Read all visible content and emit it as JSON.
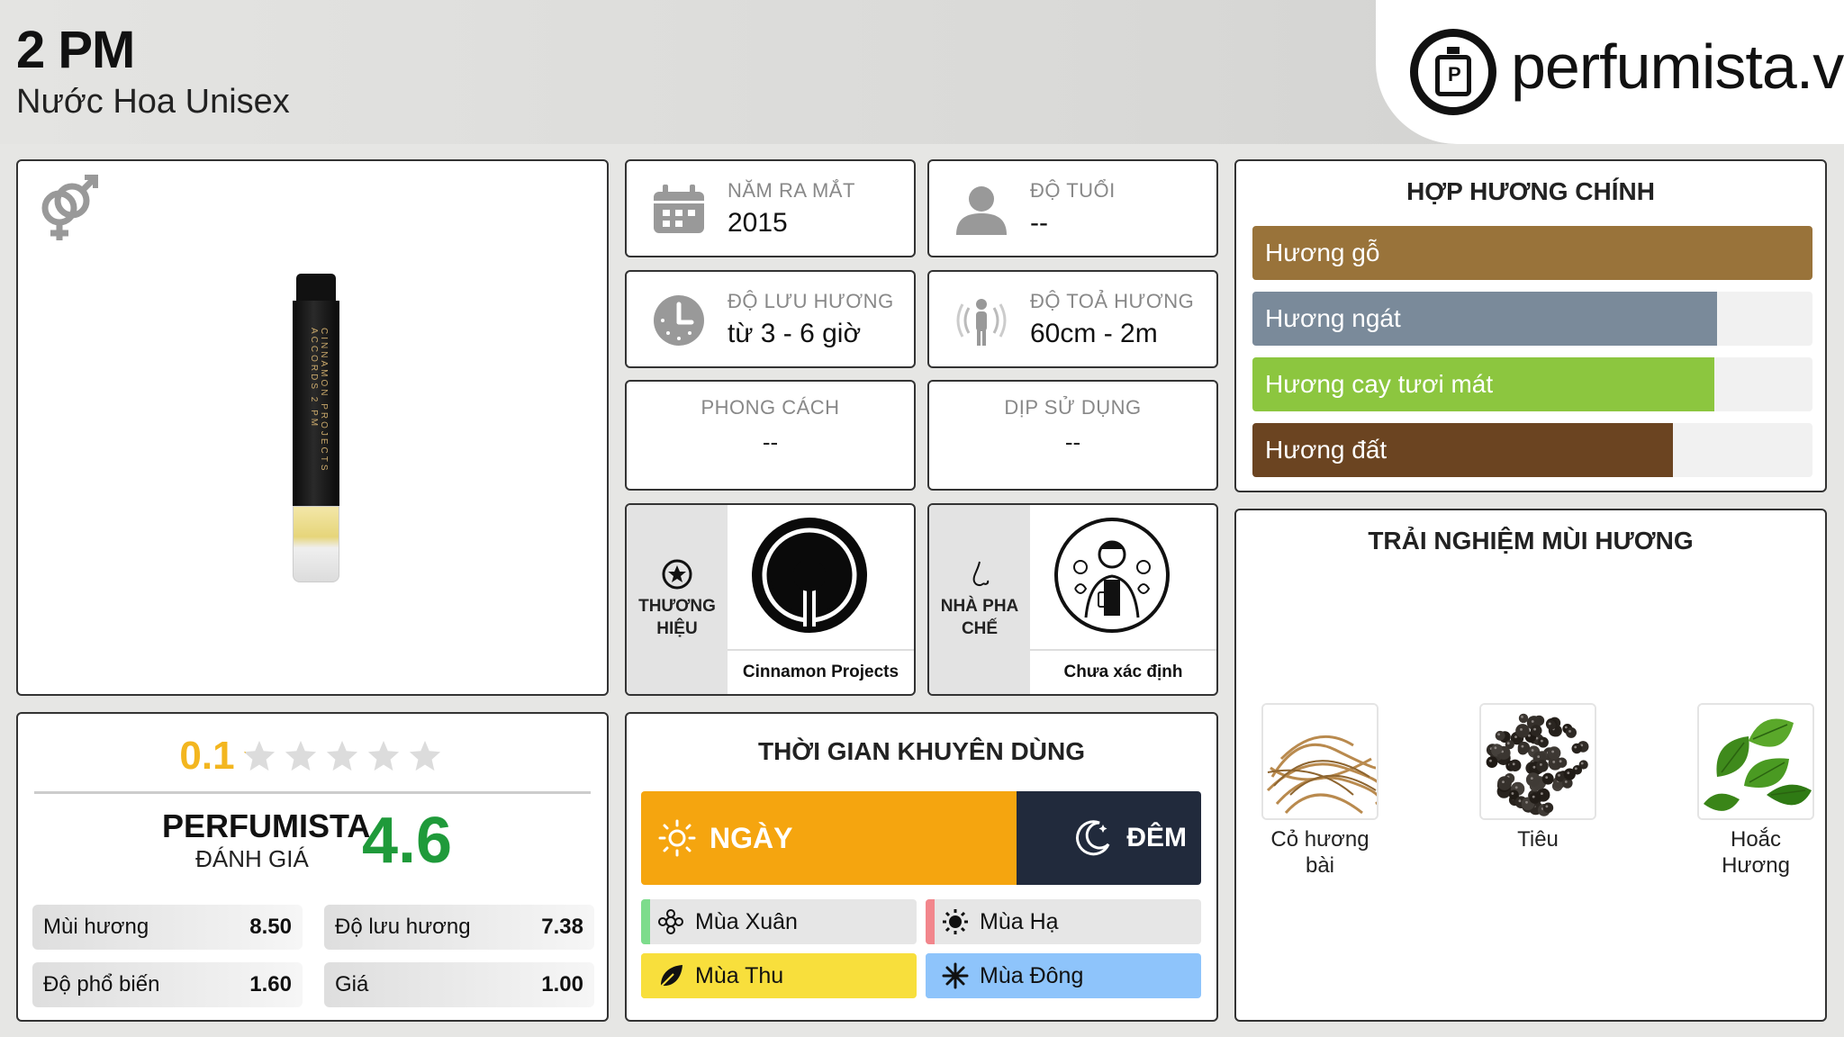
{
  "product": {
    "name": "2 PM",
    "type": "Nước Hoa Unisex",
    "logo_text": "perfumista.vn",
    "bottle_label": "CINNAMON PROJECTS ACCORDS 2 PM"
  },
  "info": {
    "release": {
      "label": "NĂM RA MẮT",
      "value": "2015"
    },
    "age": {
      "label": "ĐỘ TUỔI",
      "value": "--"
    },
    "longevity": {
      "label": "ĐỘ LƯU HƯƠNG",
      "value": "từ 3 - 6 giờ"
    },
    "sillage": {
      "label": "ĐỘ TOẢ HƯƠNG",
      "value": "60cm - 2m"
    },
    "style": {
      "label": "PHONG CÁCH",
      "value": "--"
    },
    "occasion": {
      "label": "DỊP SỬ DỤNG",
      "value": "--"
    }
  },
  "brand": {
    "label": "THƯƠNG HIỆU",
    "name": "Cinnamon Projects"
  },
  "perfumer": {
    "label": "NHÀ PHA CHẾ",
    "name": "Chưa xác định"
  },
  "accords": {
    "title": "HỢP HƯƠNG CHÍNH",
    "items": [
      {
        "name": "Hương gỗ",
        "fill": 1.0,
        "color": "#99733a"
      },
      {
        "name": "Hương ngát",
        "fill": 0.83,
        "color": "#7a8a9a"
      },
      {
        "name": "Hương cay tươi mát",
        "fill": 0.825,
        "color": "#8cc63f"
      },
      {
        "name": "Hương đất",
        "fill": 0.75,
        "color": "#6b4421"
      }
    ]
  },
  "notes": {
    "title": "TRẢI NGHIỆM MÙI HƯƠNG",
    "items": [
      {
        "name": "Cỏ hương bài"
      },
      {
        "name": "Tiêu"
      },
      {
        "name": "Hoắc Hương"
      }
    ]
  },
  "rating": {
    "user_score": "0.1",
    "user_stars": 0.02,
    "perfumista_name": "PERFUMISTA",
    "perfumista_sub": "ĐÁNH GIÁ",
    "perfumista_score": "4.6",
    "metrics": [
      {
        "label": "Mùi hương",
        "value": "8.50"
      },
      {
        "label": "Độ lưu hương",
        "value": "7.38"
      },
      {
        "label": "Độ phổ biến",
        "value": "1.60"
      },
      {
        "label": "Giá",
        "value": "1.00"
      }
    ]
  },
  "time": {
    "title": "THỜI GIAN KHUYÊN DÙNG",
    "day_label": "NGÀY",
    "night_label": "ĐÊM",
    "day_fraction": 0.67,
    "seasons": [
      {
        "name": "Mùa Xuân",
        "tag": "#7ddc8c",
        "bg": "#e6e6e6"
      },
      {
        "name": "Mùa Hạ",
        "tag": "#f2868c",
        "bg": "#e6e6e6"
      },
      {
        "name": "Mùa Thu",
        "tag": "#f8df3c",
        "bg": "#f8df3c"
      },
      {
        "name": "Mùa Đông",
        "tag": "#8ec4fb",
        "bg": "#8ec4fb"
      }
    ]
  }
}
